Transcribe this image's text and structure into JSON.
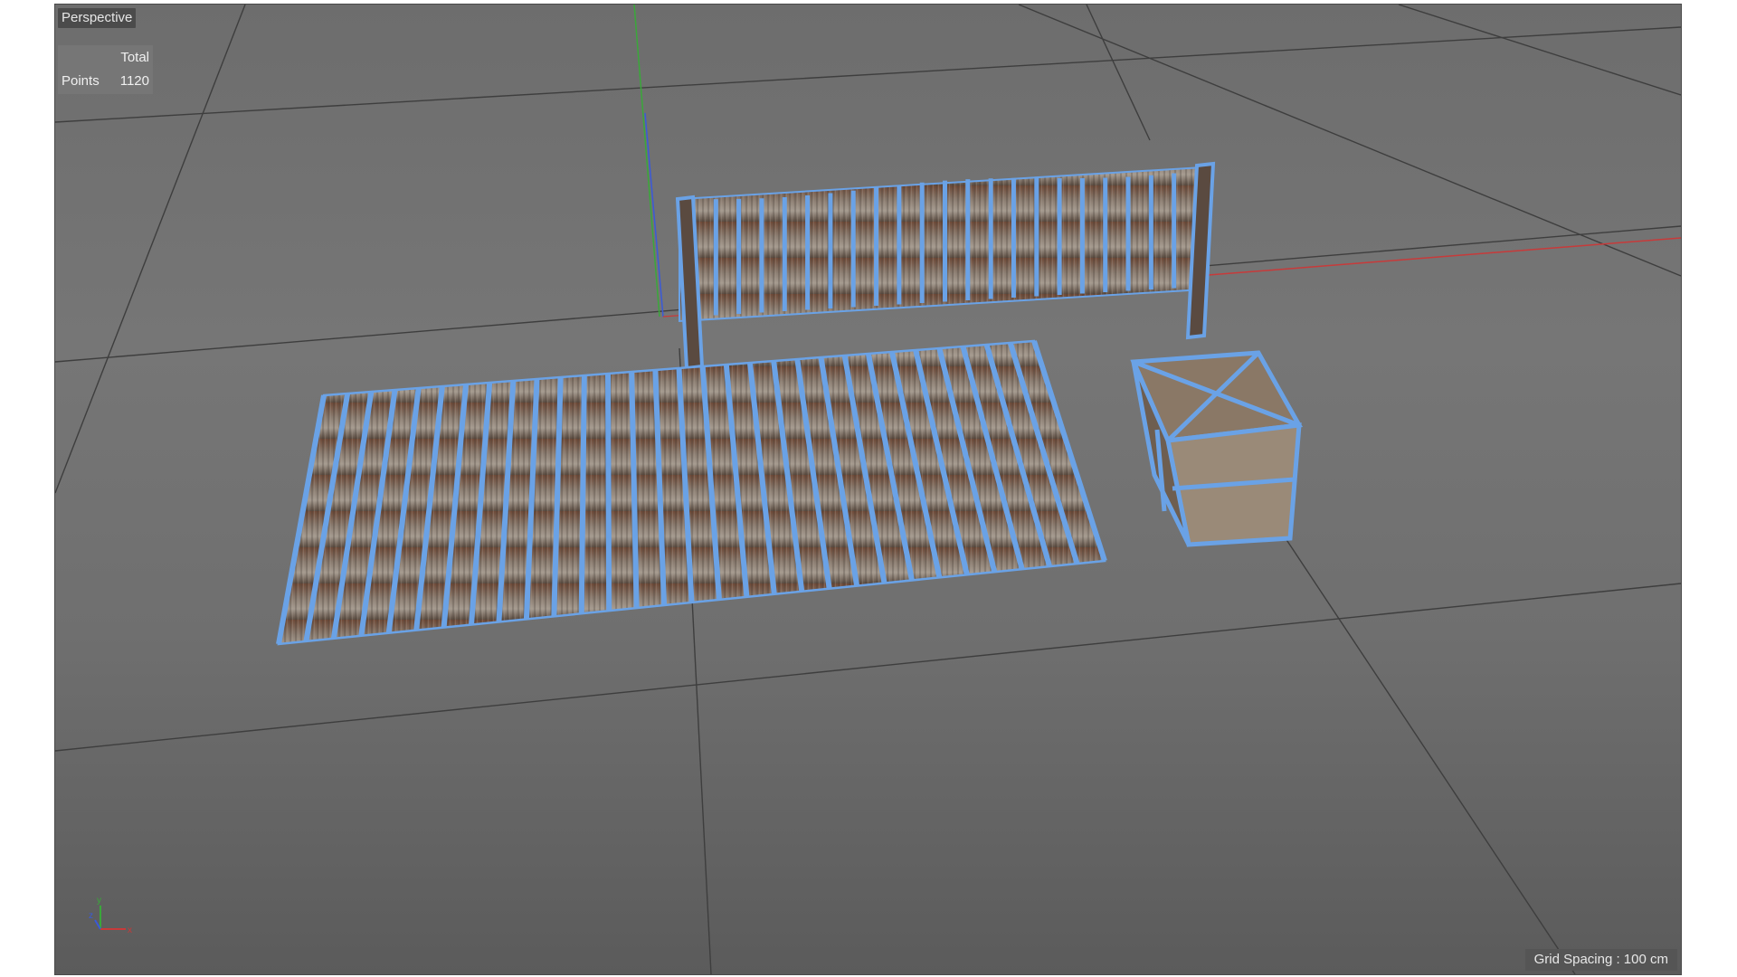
{
  "viewport": {
    "view_name": "Perspective",
    "stats": {
      "column_header": "Total",
      "row_label": "Points",
      "row_value": "1120"
    },
    "grid_spacing": "Grid Spacing : 100 cm",
    "axes": {
      "x": "x",
      "y": "y",
      "z": "z"
    }
  },
  "colors": {
    "background_top": "#6d6d6d",
    "background_bottom": "#5b5b5b",
    "grid_line": "#3e3e3e",
    "x_axis": "#c83a3a",
    "y_axis": "#3aa83a",
    "z_axis": "#3a5ad8",
    "wireframe": "#6aa2e6",
    "wood_dark": "#4a4038",
    "wood_light": "#8a7a68",
    "wood_red": "#7a5440"
  },
  "objects": [
    "fence-object",
    "floor-planks-object",
    "crate-object"
  ]
}
